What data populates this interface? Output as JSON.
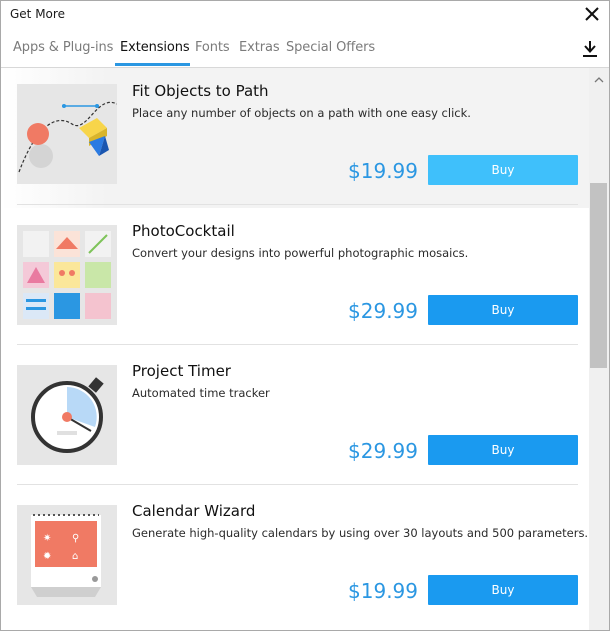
{
  "window": {
    "title": "Get More"
  },
  "tabs": [
    {
      "label": "Apps & Plug-ins",
      "active": false
    },
    {
      "label": "Extensions",
      "active": true
    },
    {
      "label": "Fonts",
      "active": false
    },
    {
      "label": "Extras",
      "active": false
    },
    {
      "label": "Special Offers",
      "active": false
    }
  ],
  "items": [
    {
      "title": "Fit Objects to Path",
      "description": "Place any number of objects on a path with one easy click.",
      "price": "$19.99",
      "buy_label": "Buy"
    },
    {
      "title": "PhotoCocktail",
      "description": "Convert your designs into powerful photographic mosaics.",
      "price": "$29.99",
      "buy_label": "Buy"
    },
    {
      "title": "Project Timer",
      "description": "Automated time tracker",
      "price": "$29.99",
      "buy_label": "Buy"
    },
    {
      "title": "Calendar Wizard",
      "description": "Generate high-quality calendars by using over 30 layouts and 500 parameters.",
      "price": "$19.99",
      "buy_label": "Buy"
    }
  ],
  "colors": {
    "accent": "#2b97e2",
    "buy_button": "#1a9af0",
    "buy_button_hover": "#3fc0fb"
  },
  "icons": {
    "close": "close-icon",
    "download": "download-icon",
    "scroll_up": "chevron-up-icon"
  }
}
